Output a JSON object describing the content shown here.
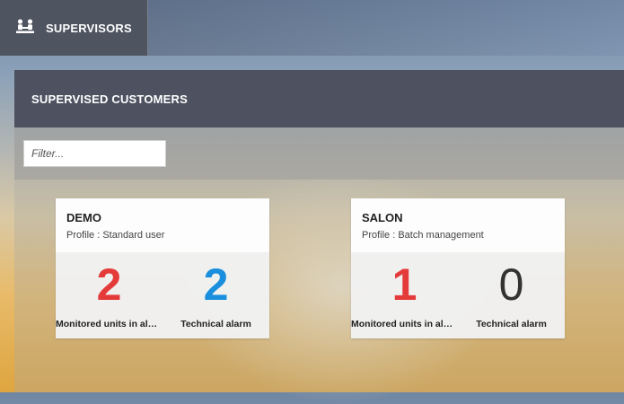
{
  "nav": {
    "supervisors_label": "SUPERVISORS",
    "icon": "supervisors-icon"
  },
  "panel": {
    "title": "SUPERVISED CUSTOMERS"
  },
  "filter": {
    "placeholder": "Filter..."
  },
  "colors": {
    "alarm": "#e43a3a",
    "technical": "#1a8fdd",
    "neutral": "#333333"
  },
  "customers": [
    {
      "name": "DEMO",
      "profile": "Profile : Standard user",
      "monitored_units_in_alarm": "2",
      "monitored_label": "Monitored units in alarm",
      "technical_alarm": "2",
      "technical_label": "Technical alarm"
    },
    {
      "name": "SALON",
      "profile": "Profile : Batch management",
      "monitored_units_in_alarm": "1",
      "monitored_label": "Monitored units in alarm",
      "technical_alarm": "0",
      "technical_label": "Technical alarm"
    }
  ]
}
